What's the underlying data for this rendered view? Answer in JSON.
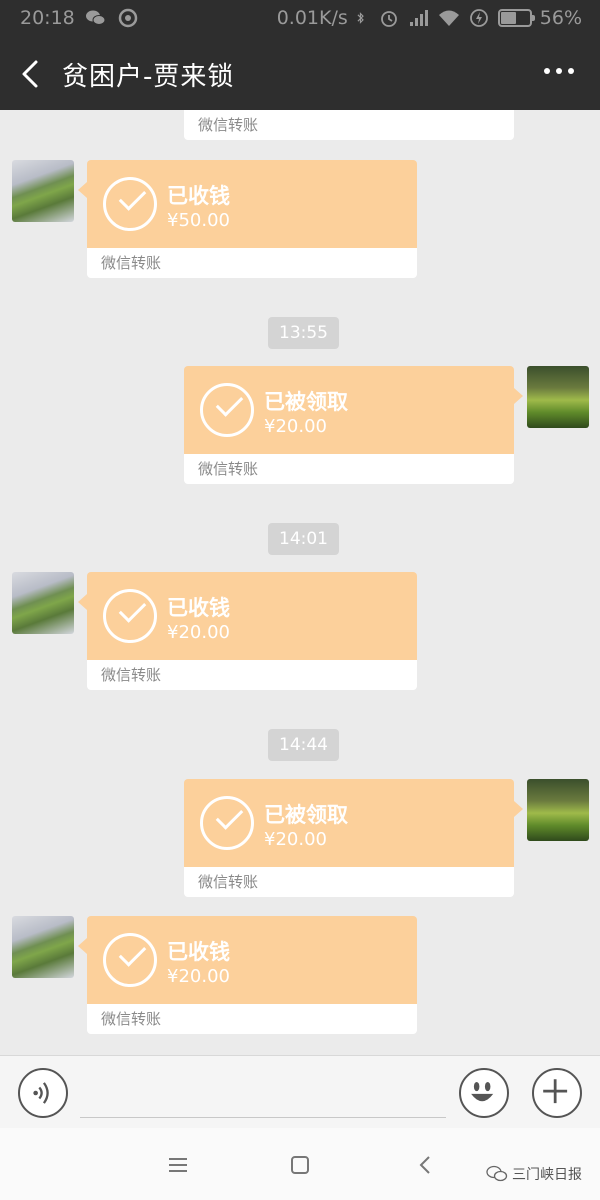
{
  "status_bar": {
    "time": "20:18",
    "speed": "0.01K/s",
    "battery": "56%",
    "battery_level": 0.56
  },
  "header": {
    "title": "贫困户-贾来锁"
  },
  "messages": [
    {
      "type": "transfer",
      "side": "right",
      "status": "",
      "amount": "",
      "caption": "微信转账",
      "partial": true
    },
    {
      "type": "transfer",
      "side": "left",
      "status": "已收钱",
      "amount": "¥50.00",
      "caption": "微信转账"
    },
    {
      "type": "time",
      "text": "13:55"
    },
    {
      "type": "transfer",
      "side": "right",
      "status": "已被领取",
      "amount": "¥20.00",
      "caption": "微信转账"
    },
    {
      "type": "time",
      "text": "14:01"
    },
    {
      "type": "transfer",
      "side": "left",
      "status": "已收钱",
      "amount": "¥20.00",
      "caption": "微信转账"
    },
    {
      "type": "time",
      "text": "14:44"
    },
    {
      "type": "transfer",
      "side": "right",
      "status": "已被领取",
      "amount": "¥20.00",
      "caption": "微信转账"
    },
    {
      "type": "transfer",
      "side": "left",
      "status": "已收钱",
      "amount": "¥20.00",
      "caption": "微信转账"
    }
  ],
  "watermark": "三门峡日报",
  "colors": {
    "header_bg": "#2e2e2e",
    "chat_bg": "#ebebeb",
    "transfer_orange": "#fcd09b"
  }
}
